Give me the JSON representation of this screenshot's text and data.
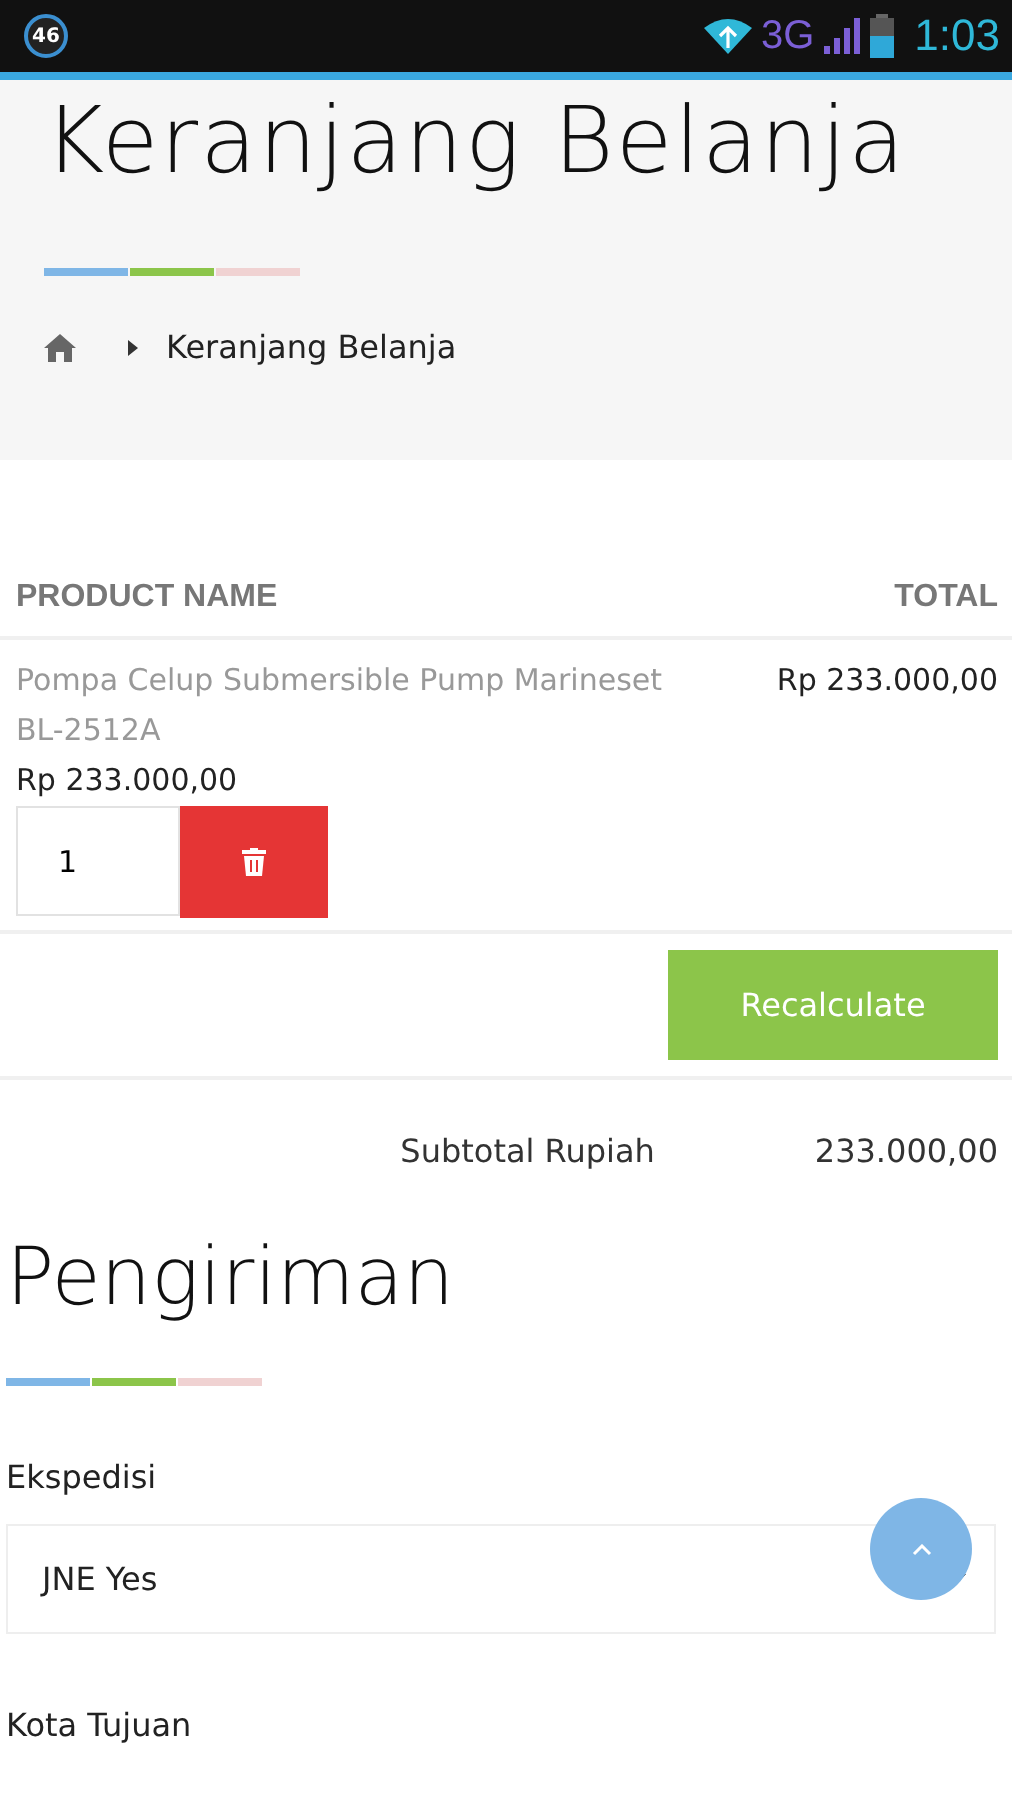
{
  "status_bar": {
    "notification_badge": "46",
    "network": "3G",
    "time": "1:03"
  },
  "page_header": {
    "title": "Keranjang Belanja",
    "breadcrumb": [
      {
        "kind": "home"
      },
      {
        "kind": "text",
        "label": "Keranjang Belanja"
      }
    ]
  },
  "cart_table": {
    "columns": [
      "PRODUCT NAME",
      "TOTAL"
    ],
    "rows": [
      {
        "name": "Pompa Celup Submersible Pump Marineset BL-2512A",
        "price": "Rp 233.000,00",
        "quantity": "1",
        "total": "Rp 233.000,00"
      }
    ]
  },
  "recalculate_button": "Recalculate",
  "subtotal": {
    "label": "Subtotal Rupiah",
    "value": "233.000,00"
  },
  "shipping": {
    "title": "Pengiriman",
    "fields": [
      {
        "kind": "select",
        "label": "Ekspedisi",
        "value": "JNE Yes"
      },
      {
        "kind": "label_only",
        "label": "Kota Tujuan"
      }
    ]
  }
}
